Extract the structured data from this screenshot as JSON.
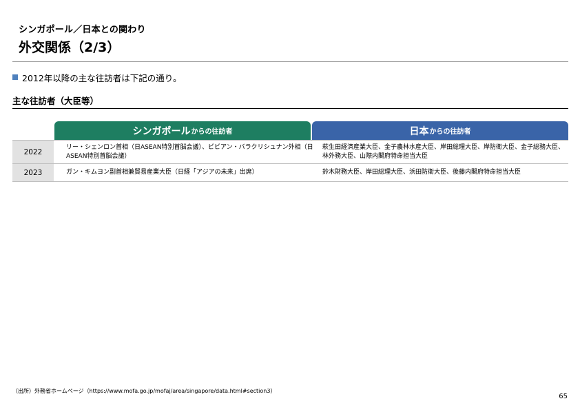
{
  "header": {
    "subtitle": "シンガポール／日本との関わり",
    "title": "外交関係（2/3）"
  },
  "bullet": {
    "text": "2012年以降の主な往訪者は下記の通り。",
    "marker_color": "#4f81bd"
  },
  "section": {
    "heading": "主な往訪者（大臣等）"
  },
  "table": {
    "columns": [
      {
        "main": "シンガポール",
        "sub": "からの往訪者",
        "color": "#1e7e61"
      },
      {
        "main": "日本",
        "sub": "からの往訪者",
        "color": "#3a64a8"
      }
    ],
    "rows": [
      {
        "year": "2022",
        "singapore": "リー・シェンロン首相（日ASEAN特別首脳会議）、ビビアン・バラクリシュナン外相（日ASEAN特別首脳会議）",
        "japan": "萩生田経済産業大臣、金子農林水産大臣、岸田総理大臣、岸防衛大臣、金子総務大臣、林外務大臣、山際内閣府特命担当大臣"
      },
      {
        "year": "2023",
        "singapore": "ガン・キムヨン副首相兼貿易産業大臣（日経「アジアの未来」出席）",
        "japan": "鈴木財務大臣、岸田総理大臣、浜田防衛大臣、後藤内閣府特命担当大臣"
      }
    ]
  },
  "footer": {
    "source": "（出所）外務省ホームページ（https://www.mofa.go.jp/mofaj/area/singapore/data.html#section3）",
    "page_number": "65"
  }
}
